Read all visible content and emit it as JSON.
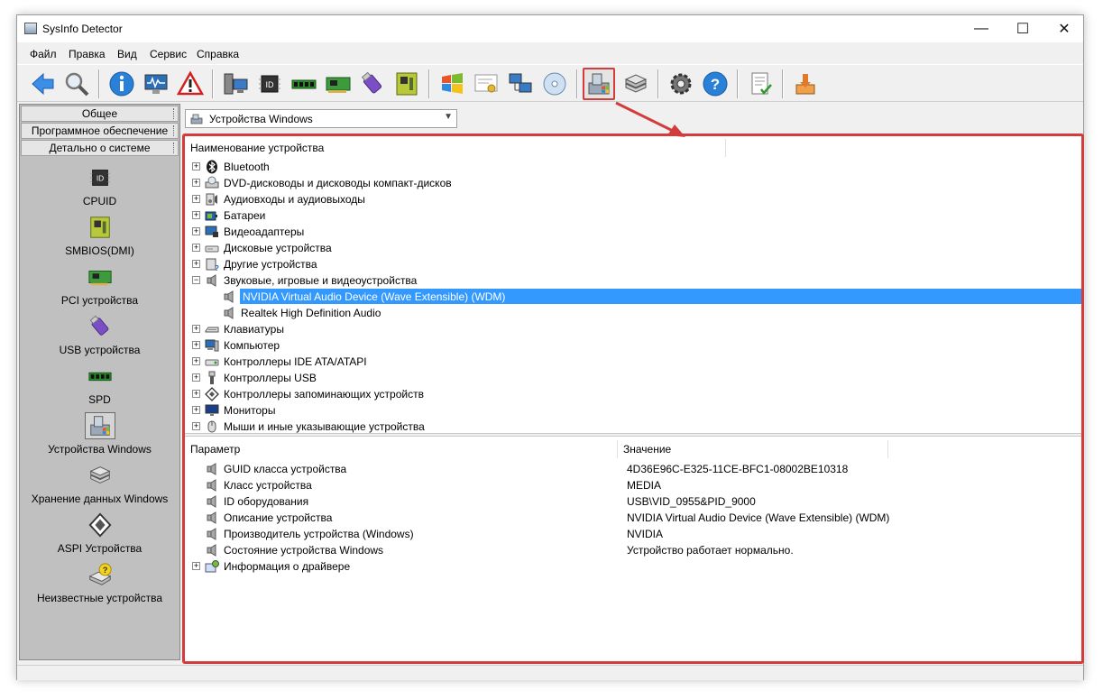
{
  "window": {
    "title": "SysInfo Detector"
  },
  "menu": [
    "Файл",
    "Правка",
    "Вид",
    "Сервис",
    "Справка"
  ],
  "toolbar": {
    "buttons": [
      "back-icon",
      "search-icon",
      "info-icon",
      "monitor-icon",
      "warning-icon",
      "computer-icon",
      "cpu-id-icon",
      "memory-icon",
      "pci-card-icon",
      "usb-icon",
      "motherboard-icon",
      "windows-icon",
      "certificate-icon",
      "network-icon",
      "disc-icon",
      "windows-devices-icon",
      "storage-icon",
      "settings-icon",
      "help-icon",
      "report-icon",
      "export-icon"
    ],
    "active_button": "windows-devices-icon"
  },
  "sidebar": {
    "tabs": [
      "Общее",
      "Программное обеспечение",
      "Детально о системе"
    ],
    "items": [
      {
        "label": "CPUID",
        "icon": "cpu-id-icon"
      },
      {
        "label": "SMBIOS(DMI)",
        "icon": "motherboard-icon"
      },
      {
        "label": "PCI устройства",
        "icon": "pci-card-icon"
      },
      {
        "label": "USB устройства",
        "icon": "usb-icon"
      },
      {
        "label": "SPD",
        "icon": "memory-icon"
      },
      {
        "label": "Устройства Windows",
        "icon": "windows-devices-icon",
        "selected": true
      },
      {
        "label": "Хранение данных Windows",
        "icon": "storage-icon"
      },
      {
        "label": "ASPI Устройства",
        "icon": "aspi-icon"
      },
      {
        "label": "Неизвестные устройства",
        "icon": "unknown-device-icon"
      }
    ]
  },
  "combo": {
    "value": "Устройства Windows"
  },
  "device_tree": {
    "header": "Наименование устройства",
    "rows": [
      {
        "label": "Bluetooth",
        "level": 0,
        "expander": "+",
        "icon": "bluetooth-icon"
      },
      {
        "label": "DVD-дисководы и дисководы компакт-дисков",
        "level": 0,
        "expander": "+",
        "icon": "dvd-drive-icon"
      },
      {
        "label": "Аудиовходы и аудиовыходы",
        "level": 0,
        "expander": "+",
        "icon": "audio-io-icon"
      },
      {
        "label": "Батареи",
        "level": 0,
        "expander": "+",
        "icon": "battery-icon"
      },
      {
        "label": "Видеоадаптеры",
        "level": 0,
        "expander": "+",
        "icon": "display-adapter-icon"
      },
      {
        "label": "Дисковые устройства",
        "level": 0,
        "expander": "+",
        "icon": "disk-drive-icon"
      },
      {
        "label": "Другие устройства",
        "level": 0,
        "expander": "+",
        "icon": "other-devices-icon"
      },
      {
        "label": "Звуковые, игровые и видеоустройства",
        "level": 0,
        "expander": "−",
        "icon": "speaker-icon"
      },
      {
        "label": "NVIDIA Virtual Audio Device (Wave Extensible) (WDM)",
        "level": 1,
        "expander": "",
        "icon": "speaker-icon",
        "selected": true
      },
      {
        "label": "Realtek High Definition Audio",
        "level": 1,
        "expander": "",
        "icon": "speaker-icon"
      },
      {
        "label": "Клавиатуры",
        "level": 0,
        "expander": "+",
        "icon": "keyboard-icon"
      },
      {
        "label": "Компьютер",
        "level": 0,
        "expander": "+",
        "icon": "computer-icon"
      },
      {
        "label": "Контроллеры IDE ATA/ATAPI",
        "level": 0,
        "expander": "+",
        "icon": "ide-controller-icon"
      },
      {
        "label": "Контроллеры USB",
        "level": 0,
        "expander": "+",
        "icon": "usb-plug-icon"
      },
      {
        "label": "Контроллеры запоминающих устройств",
        "level": 0,
        "expander": "+",
        "icon": "storage-controller-icon"
      },
      {
        "label": "Мониторы",
        "level": 0,
        "expander": "+",
        "icon": "monitor-icon"
      },
      {
        "label": "Мыши и иные указывающие устройства",
        "level": 0,
        "expander": "+",
        "icon": "mouse-icon"
      }
    ]
  },
  "properties": {
    "headers": [
      "Параметр",
      "Значение"
    ],
    "rows": [
      {
        "key": "GUID класса устройства",
        "value": "4D36E96C-E325-11CE-BFC1-08002BE10318",
        "icon": "speaker-icon"
      },
      {
        "key": "Класс устройства",
        "value": "MEDIA",
        "icon": "speaker-icon"
      },
      {
        "key": "ID оборудования",
        "value": "USB\\VID_0955&PID_9000",
        "icon": "speaker-icon"
      },
      {
        "key": "Описание устройства",
        "value": "NVIDIA Virtual Audio Device (Wave Extensible) (WDM)",
        "icon": "speaker-icon"
      },
      {
        "key": "Производитель устройства (Windows)",
        "value": "NVIDIA",
        "icon": "speaker-icon"
      },
      {
        "key": "Состояние устройства Windows",
        "value": "Устройство работает нормально.",
        "icon": "speaker-icon"
      },
      {
        "key": "Информация о драйвере",
        "value": "",
        "icon": "driver-info-icon",
        "expander": "+"
      }
    ]
  },
  "colors": {
    "highlight": "#d43c3c",
    "selection": "#3399ff"
  }
}
